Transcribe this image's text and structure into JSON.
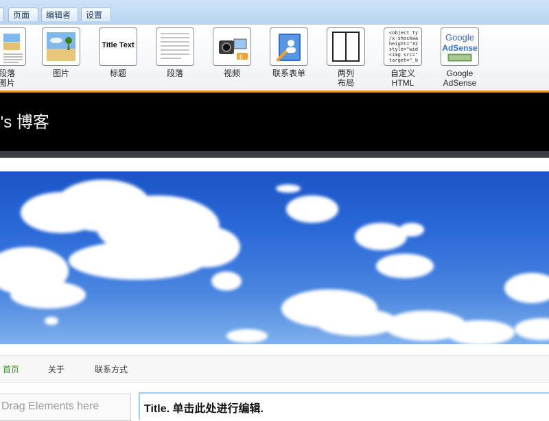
{
  "tabs": [
    {
      "label": "页面"
    },
    {
      "label": "编辑者"
    },
    {
      "label": "设置"
    }
  ],
  "toolbar": {
    "items": [
      {
        "label": "段落\n图片",
        "icon": "paragraph-image-icon"
      },
      {
        "label": "图片",
        "icon": "image-icon"
      },
      {
        "label": "标题",
        "icon": "title-icon",
        "icon_text": "Title Text"
      },
      {
        "label": "段落",
        "icon": "paragraph-icon"
      },
      {
        "label": "视频",
        "icon": "video-icon"
      },
      {
        "label": "联系表单",
        "icon": "contact-form-icon"
      },
      {
        "label": "两列\n布局",
        "icon": "two-column-icon"
      },
      {
        "label": "自定义\nHTML",
        "icon": "custom-html-icon",
        "icon_text": "<object ty\n/x-shockwa\nheight=\"32\nstyle=\"wid\n<img src=\"\ntarget=\"_b"
      },
      {
        "label": "Google\nAdSense",
        "icon": "google-adsense-icon",
        "icon_text_1": "Google",
        "icon_text_2": "AdSense"
      }
    ]
  },
  "header": {
    "site_title": " 's 博客"
  },
  "nav": {
    "items": [
      {
        "label": "首页"
      },
      {
        "label": "关于"
      },
      {
        "label": "联系方式"
      }
    ]
  },
  "content": {
    "drop_text": "Drag Elements here",
    "title_text": "Title. 单击此处进行编辑."
  },
  "colors": {
    "accent": "#e59a1a",
    "nav_active": "#3f8f1f",
    "header_bg": "#000000"
  }
}
